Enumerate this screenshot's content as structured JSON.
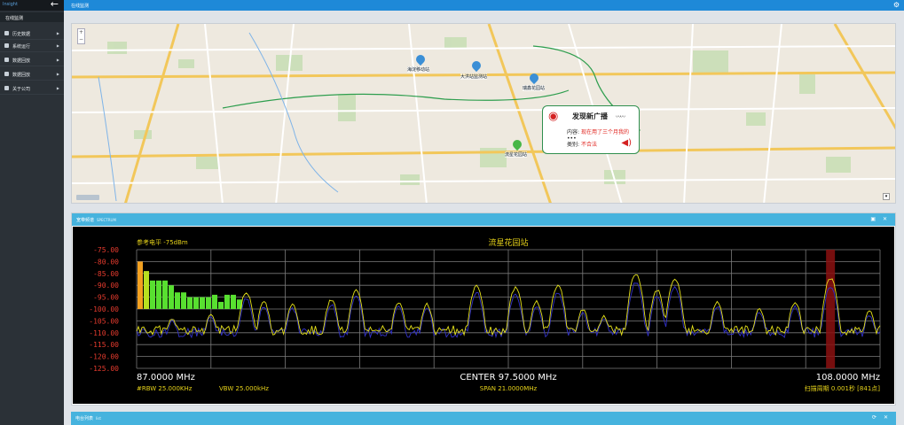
{
  "sidebar": {
    "brand": "Insight",
    "active": "在线监测",
    "items": [
      {
        "label": "历史数据",
        "icon": "history-icon"
      },
      {
        "label": "系统运行",
        "icon": "run-icon"
      },
      {
        "label": "数据回放",
        "icon": "playback-icon"
      },
      {
        "label": "数据回放",
        "icon": "playback2-icon"
      },
      {
        "label": "关于公司",
        "icon": "company-icon"
      }
    ]
  },
  "topbar": {
    "tab": "在线监测"
  },
  "map": {
    "stations": [
      {
        "name": "海淀移动站"
      },
      {
        "name": "大洪站监测站"
      },
      {
        "name": "瑞鑫花园站"
      },
      {
        "name": "流星花园站"
      }
    ],
    "popup": {
      "title": "发现新广播",
      "content_label": "内容:",
      "content_value": "现在用了三个月我的",
      "content_more": "•••",
      "category_label": "类别:",
      "category_value": "不合法"
    }
  },
  "spectrum_panel": {
    "title": "宽带频谱",
    "subtitle": "SPECTRUM",
    "buttons": "▣ ✕"
  },
  "station_panel": {
    "title": "电台列表",
    "subtitle": "list",
    "buttons": "⟳ ✕"
  },
  "chart_data": {
    "type": "line",
    "title": "流星花园站",
    "ref_level": "参考电平 -75dBm",
    "ylim": [
      -125,
      -75
    ],
    "yticks": [
      "-75.00",
      "-80.00",
      "-85.00",
      "-90.00",
      "-95.00",
      "-100.00",
      "-105.00",
      "-110.00",
      "-115.00",
      "-120.00",
      "-125.00"
    ],
    "x_start": "87.0000 MHz",
    "x_center": "CENTER 97.5000 MHz",
    "x_end": "108.0000 MHz",
    "rbw": "#RBW 25.000KHz",
    "vbw": "VBW 25.000kHz",
    "span": "SPAN 21.0000MHz",
    "sweep": "扫描周期 0.001秒 [841点]",
    "freq_range": [
      87.0,
      108.0
    ],
    "highlight_freq": 106.6,
    "peaks": [
      {
        "f": 87.2,
        "a": -108
      },
      {
        "f": 88.0,
        "a": -104
      },
      {
        "f": 89.1,
        "a": -102
      },
      {
        "f": 90.1,
        "a": -93
      },
      {
        "f": 90.6,
        "a": -97
      },
      {
        "f": 91.4,
        "a": -98
      },
      {
        "f": 92.5,
        "a": -96
      },
      {
        "f": 93.2,
        "a": -92
      },
      {
        "f": 94.4,
        "a": -97
      },
      {
        "f": 95.2,
        "a": -98
      },
      {
        "f": 96.6,
        "a": -90
      },
      {
        "f": 97.7,
        "a": -91
      },
      {
        "f": 98.3,
        "a": -97
      },
      {
        "f": 98.9,
        "a": -90
      },
      {
        "f": 99.6,
        "a": -100
      },
      {
        "f": 100.2,
        "a": -103
      },
      {
        "f": 101.1,
        "a": -85
      },
      {
        "f": 101.7,
        "a": -92
      },
      {
        "f": 102.2,
        "a": -87
      },
      {
        "f": 103.4,
        "a": -97
      },
      {
        "f": 104.6,
        "a": -100
      },
      {
        "f": 105.6,
        "a": -97
      },
      {
        "f": 106.6,
        "a": -87
      },
      {
        "f": 107.7,
        "a": -101
      }
    ],
    "level_bars": [
      -80,
      -84,
      -88,
      -88,
      -88,
      -90,
      -93,
      -93,
      -95,
      -95,
      -95,
      -95,
      -94,
      -97,
      -94,
      -94,
      -96
    ],
    "colors": {
      "trace_yellow": "#e6e21a",
      "trace_blue": "#3232c8",
      "highlight": "#8b1010",
      "grid": "#7a7a7a",
      "text_yellow": "#e6d21a"
    }
  }
}
